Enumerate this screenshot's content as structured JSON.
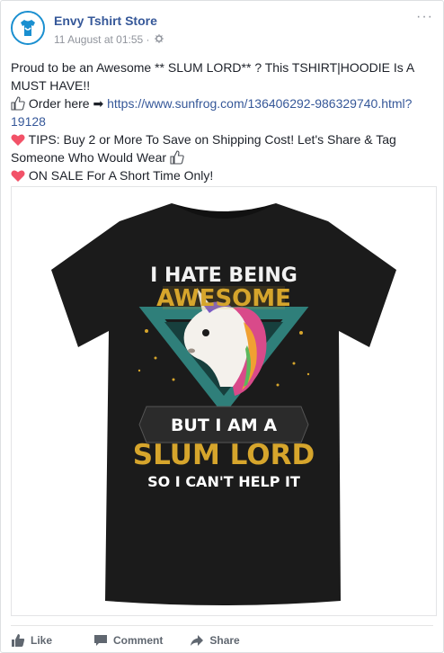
{
  "post": {
    "page_name": "Envy Tshirt Store",
    "timestamp": "11 August at 01:55",
    "separator": "·",
    "more": "···",
    "line1": "Proud to be an Awesome ** SLUM LORD** ? This TSHIRT|HOODIE Is A MUST HAVE!!",
    "order_label": " Order here ",
    "arrow": "➡",
    "link": "https://www.sunfrog.com/136406292-986329740.html?19128",
    "tips": " TIPS: Buy 2 or More To Save on Shipping Cost! Let's Share & Tag Someone Who Would Wear ",
    "sale": " ON SALE For A Short Time Only!"
  },
  "shirt": {
    "line1": "I HATE BEING",
    "line2": "AWESOME",
    "line3": "BUT I AM A",
    "line4": "SLUM LORD",
    "line5": "SO I CAN'T HELP IT"
  },
  "actions": {
    "like": "Like",
    "comment": "Comment",
    "share": "Share"
  },
  "colors": {
    "link": "#365899",
    "heart": "#f25268",
    "gold": "#d6a52c",
    "teal": "#2f7f7a"
  }
}
